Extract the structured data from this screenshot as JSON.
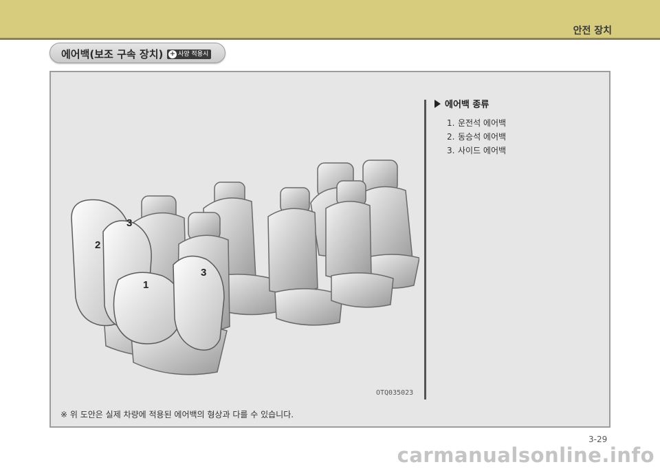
{
  "header": {
    "chapter_title": "안전 장치"
  },
  "section": {
    "title": "에어백(보조 구속 장치)",
    "option_badge": "사양 적용시"
  },
  "illustration": {
    "code": "OTQ035023",
    "callouts": [
      "3",
      "2",
      "1",
      "3"
    ]
  },
  "legend": {
    "title": "에어백 종류",
    "items": [
      {
        "num": "1.",
        "label": "운전석 에어백"
      },
      {
        "num": "2.",
        "label": "동승석 에어백"
      },
      {
        "num": "3.",
        "label": "사이드 에어백"
      }
    ]
  },
  "footnote": "※ 위 도안은 실제 차량에 적용된 에어백의 형상과 다를 수 있습니다.",
  "page_number": "3-29",
  "watermark": "carmanualsonline.info"
}
